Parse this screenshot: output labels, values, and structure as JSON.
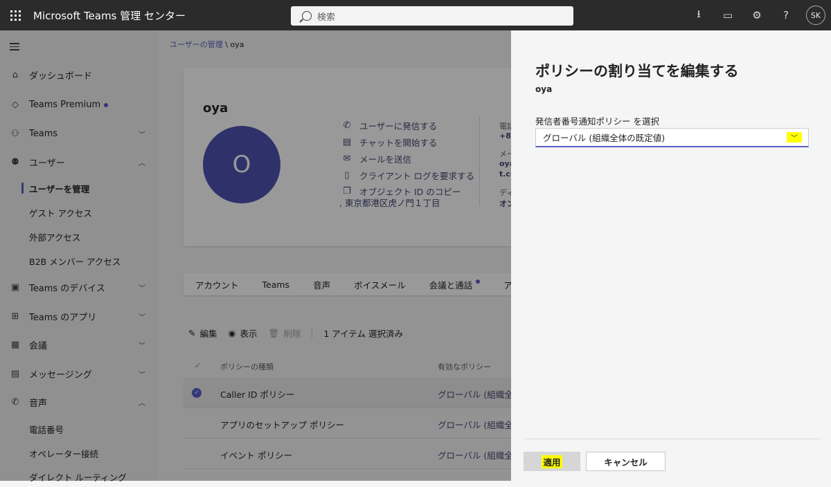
{
  "topbar": {
    "app_title": "Microsoft Teams 管理 センター",
    "search_placeholder": "検索",
    "avatar_initials": "SK"
  },
  "sidebar": {
    "items": [
      {
        "label": "ダッシュボード",
        "icon": "home-icon"
      },
      {
        "label": "Teams Premium",
        "icon": "diamond-icon"
      },
      {
        "label": "Teams",
        "icon": "teams-icon"
      },
      {
        "label": "ユーザー",
        "icon": "users-icon"
      },
      {
        "label": "ユーザーを管理"
      },
      {
        "label": "ゲスト アクセス"
      },
      {
        "label": "外部アクセス"
      },
      {
        "label": "B2B メンバー アクセス"
      },
      {
        "label": "Teams のデバイス",
        "icon": "devices-icon"
      },
      {
        "label": "Teams のアプリ",
        "icon": "apps-icon"
      },
      {
        "label": "会議",
        "icon": "calendar-icon"
      },
      {
        "label": "メッセージング",
        "icon": "chat-icon"
      },
      {
        "label": "音声",
        "icon": "phone-icon"
      },
      {
        "label": "電話番号"
      },
      {
        "label": "オペレーター接続"
      },
      {
        "label": "ダイレクト ルーティング"
      }
    ]
  },
  "main": {
    "breadcrumb_link": "ユーザーの管理",
    "breadcrumb_sep": " \\ ",
    "breadcrumb_current": "oya",
    "user_name": "oya",
    "avatar_letter": "O",
    "actions": [
      "ユーザーに発信する",
      "チャットを開始する",
      "メールを送信",
      "クライアント ログを要求する",
      "オブジェクト ID のコピー"
    ],
    "address": ", 東京都港区虎ノ門１丁目",
    "contact": [
      "電話",
      "+8",
      "メー",
      "oya",
      "t.co",
      "ディ",
      "オン"
    ],
    "tabs": [
      "アカウント",
      "Teams",
      "音声",
      "ボイスメール",
      "会議と通話",
      "アプ"
    ],
    "commands": {
      "edit": "編集",
      "view": "表示",
      "delete": "削除",
      "selected": "1 アイテム 選択済み"
    },
    "table": {
      "headers": [
        "ポリシーの種類",
        "有効なポリシー"
      ],
      "rows": [
        {
          "type": "Caller ID ポリシー",
          "policy": "グローバル (組織全"
        },
        {
          "type": "アプリのセットアップ ポリシー",
          "policy": "グローバル (組織全"
        },
        {
          "type": "イベント ポリシー",
          "policy": "グローバル (組織全"
        }
      ]
    }
  },
  "panel": {
    "title": "ポリシーの割り当てを編集する",
    "subtitle": "oya",
    "label": "発信者番号通知ポリシー を選択",
    "selected_value": "グローバル (組織全体の既定値)",
    "apply_label": "適用",
    "cancel_label": "キャンセル"
  },
  "colors": {
    "accent": "#5b5fc7",
    "highlight": "#ffff00",
    "topbar": "#2b2b2b"
  }
}
